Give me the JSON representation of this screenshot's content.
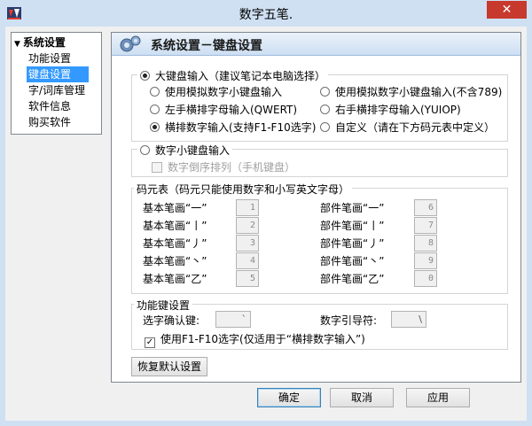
{
  "window": {
    "title": "数字五笔.",
    "close_label": "✕"
  },
  "nav": {
    "root_label": "系统设置",
    "items": [
      {
        "label": "功能设置",
        "selected": false
      },
      {
        "label": "键盘设置",
        "selected": true
      },
      {
        "label": "字/词库管理",
        "selected": false
      },
      {
        "label": "软件信息",
        "selected": false
      },
      {
        "label": "购买软件",
        "selected": false
      }
    ]
  },
  "panel": {
    "title": "系统设置－键盘设置"
  },
  "big_keyboard": {
    "label": "大键盘输入（建议笔记本电脑选择）",
    "selected": true,
    "options": [
      {
        "label": "使用模拟数字小键盘输入",
        "selected": false
      },
      {
        "label": "使用模拟数字小键盘输入(不含789)",
        "selected": false
      },
      {
        "label": "左手横排字母输入(QWERT)",
        "selected": false
      },
      {
        "label": "右手横排字母输入(YUIOP)",
        "selected": false
      },
      {
        "label": "横排数字输入(支持F1-F10选字)",
        "selected": true
      },
      {
        "label": "自定义（请在下方码元表中定义）",
        "selected": false
      }
    ]
  },
  "numpad": {
    "label": "数字小键盘输入",
    "selected": false,
    "reverse_label": "数字倒序排列（手机键盘）",
    "reverse_checked": false
  },
  "code_table": {
    "label": "码元表（码元只能使用数字和小写英文字母）",
    "basic": [
      {
        "label": "基本笔画“一”",
        "value": "1"
      },
      {
        "label": "基本笔画“丨”",
        "value": "2"
      },
      {
        "label": "基本笔画“丿”",
        "value": "3"
      },
      {
        "label": "基本笔画“丶”",
        "value": "4"
      },
      {
        "label": "基本笔画“乙”",
        "value": "5"
      }
    ],
    "component": [
      {
        "label": "部件笔画“一”",
        "value": "6"
      },
      {
        "label": "部件笔画“丨”",
        "value": "7"
      },
      {
        "label": "部件笔画“丿”",
        "value": "8"
      },
      {
        "label": "部件笔画“丶”",
        "value": "9"
      },
      {
        "label": "部件笔画“乙”",
        "value": "0"
      }
    ]
  },
  "function_keys": {
    "label": "功能键设置",
    "confirm_label": "选字确认键:",
    "confirm_value": "`",
    "guide_label": "数字引导符:",
    "guide_value": "\\",
    "f1f10_label": "使用F1-F10选字(仅适用于“横排数字输入”)",
    "f1f10_checked": true
  },
  "buttons": {
    "restore": "恢复默认设置",
    "ok": "确定",
    "cancel": "取消",
    "apply": "应用"
  }
}
